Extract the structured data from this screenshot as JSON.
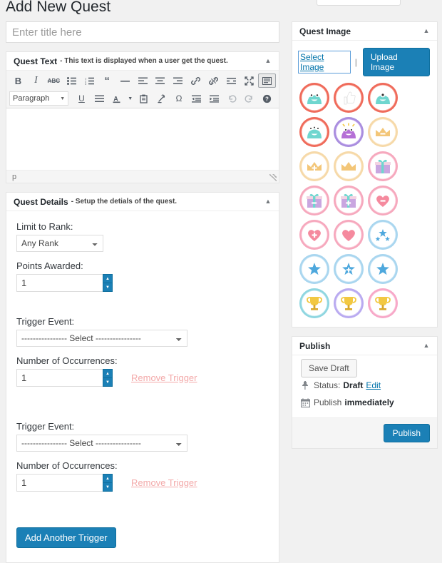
{
  "page": {
    "title": "Add New Quest"
  },
  "title_field": {
    "placeholder": "Enter title here",
    "value": ""
  },
  "quest_text_box": {
    "title": "Quest Text",
    "subtitle": "- This text is displayed when a user get the quest.",
    "toolbar_row1": [
      {
        "name": "bold-icon",
        "label": "B"
      },
      {
        "name": "italic-icon",
        "label": "I"
      },
      {
        "name": "strikethrough-icon",
        "label": "ABC"
      },
      {
        "name": "bulleted-list-icon",
        "label": ""
      },
      {
        "name": "numbered-list-icon",
        "label": ""
      },
      {
        "name": "blockquote-icon",
        "label": "“"
      },
      {
        "name": "horizontal-rule-icon",
        "label": "—"
      },
      {
        "name": "align-left-icon",
        "label": ""
      },
      {
        "name": "align-center-icon",
        "label": ""
      },
      {
        "name": "align-right-icon",
        "label": ""
      },
      {
        "name": "insert-link-icon",
        "label": ""
      },
      {
        "name": "unlink-icon",
        "label": ""
      },
      {
        "name": "read-more-icon",
        "label": ""
      },
      {
        "name": "fullscreen-icon",
        "label": ""
      },
      {
        "name": "toolbar-toggle-icon",
        "label": ""
      }
    ],
    "format_select": {
      "value": "Paragraph"
    },
    "toolbar_row2": [
      {
        "name": "underline-icon",
        "label": "U"
      },
      {
        "name": "justify-icon",
        "label": ""
      },
      {
        "name": "text-color-icon",
        "label": "A"
      },
      {
        "name": "text-color-chevron-icon",
        "label": ""
      },
      {
        "name": "paste-as-text-icon",
        "label": ""
      },
      {
        "name": "clear-formatting-icon",
        "label": ""
      },
      {
        "name": "special-character-icon",
        "label": "Ω"
      },
      {
        "name": "decrease-indent-icon",
        "label": ""
      },
      {
        "name": "increase-indent-icon",
        "label": ""
      },
      {
        "name": "undo-icon",
        "label": ""
      },
      {
        "name": "redo-icon",
        "label": ""
      },
      {
        "name": "keyboard-shortcuts-help-icon",
        "label": "?"
      }
    ],
    "content": "",
    "status_path": "p"
  },
  "quest_details_box": {
    "title": "Quest Details",
    "subtitle": "- Setup the detials of the quest.",
    "limit_rank_label": "Limit to Rank:",
    "limit_rank_value": "Any Rank",
    "points_label": "Points Awarded:",
    "points_value": "1",
    "triggers": [
      {
        "event_label": "Trigger Event:",
        "event_value": "---------------- Select ----------------",
        "occurrences_label": "Number of Occurrences:",
        "occurrences_value": "1",
        "remove_label": "Remove Trigger"
      },
      {
        "event_label": "Trigger Event:",
        "event_value": "---------------- Select ----------------",
        "occurrences_label": "Number of Occurrences:",
        "occurrences_value": "1",
        "remove_label": "Remove Trigger"
      }
    ],
    "add_trigger_label": "Add Another Trigger"
  },
  "quest_image_box": {
    "title": "Quest Image",
    "select_label": "Select Image",
    "separator": "|",
    "upload_label": "Upload Image",
    "badges": [
      {
        "name": "badge-monster-happy-red",
        "kind": "monster",
        "ring": "#ef6a5a",
        "body": "#6fd6cf",
        "ray": "#f9a79a"
      },
      {
        "name": "badge-thumbs-up-red",
        "kind": "thumb",
        "ring": "#ef6a5a",
        "body": "#ffffff",
        "ray": "#f9a79a"
      },
      {
        "name": "badge-monster-cyclops-red",
        "kind": "monster1",
        "ring": "#ef6a5a",
        "body": "#6fd6cf",
        "ray": "#f9a79a"
      },
      {
        "name": "badge-monster-many-eyes-red",
        "kind": "monster3",
        "ring": "#ef6a5a",
        "body": "#6fd6cf",
        "ray": "#f9a79a"
      },
      {
        "name": "badge-monster-purple",
        "kind": "monsterp",
        "ring": "#a98ede",
        "body": "#b56fd6",
        "ray": "#c9aef0"
      },
      {
        "name": "badge-crown-gold-minus",
        "kind": "crown-minus",
        "ring": "#f6d9a8",
        "body": "#f3c678",
        "ray": "#fbe9cd"
      },
      {
        "name": "badge-crown-gold-plus",
        "kind": "crown-plus",
        "ring": "#f6d9a8",
        "body": "#f3c678",
        "ray": "#fbe9cd"
      },
      {
        "name": "badge-crown-gold",
        "kind": "crown",
        "ring": "#f6d9a8",
        "body": "#f3c678",
        "ray": "#fbe9cd"
      },
      {
        "name": "badge-gift-pink",
        "kind": "gift",
        "ring": "#f6a8bd",
        "body": "#f7a8c0",
        "ray": "#fbd0dc"
      },
      {
        "name": "badge-gift-pink-minus",
        "kind": "gift-minus",
        "ring": "#f6a8bd",
        "body": "#f7a8c0",
        "ray": "#fbd0dc"
      },
      {
        "name": "badge-gift-pink-plus",
        "kind": "gift-plus",
        "ring": "#f6a8bd",
        "body": "#f7a8c0",
        "ray": "#fbd0dc"
      },
      {
        "name": "badge-heart-minus",
        "kind": "heart-minus",
        "ring": "#f6a8bd",
        "body": "#f58a9e",
        "ray": "#fbd0dc"
      },
      {
        "name": "badge-heart-plus",
        "kind": "heart-plus",
        "ring": "#f6a8bd",
        "body": "#f58a9e",
        "ray": "#fbd0dc"
      },
      {
        "name": "badge-heart",
        "kind": "heart",
        "ring": "#f6a8bd",
        "body": "#f58a9e",
        "ray": "#fbd0dc"
      },
      {
        "name": "badge-stars-blue",
        "kind": "stars",
        "ring": "#a9d6ef",
        "body": "#4ea8dd",
        "ray": "#cfe8f7"
      },
      {
        "name": "badge-star-blue",
        "kind": "star",
        "ring": "#a9d6ef",
        "body": "#4ea8dd",
        "ray": "#cfe8f7"
      },
      {
        "name": "badge-star-blue-plus",
        "kind": "star-plus",
        "ring": "#a9d6ef",
        "body": "#4ea8dd",
        "ray": "#cfe8f7"
      },
      {
        "name": "badge-star-blue-solid",
        "kind": "star2",
        "ring": "#a9d6ef",
        "body": "#4ea8dd",
        "ray": "#cfe8f7"
      },
      {
        "name": "badge-trophy-teal",
        "kind": "trophy",
        "ring": "#8fd6e0",
        "body": "#f2c842",
        "ray": "#bfe9ef"
      },
      {
        "name": "badge-trophy-purple",
        "kind": "trophy",
        "ring": "#b9aaf0",
        "body": "#f2c842",
        "ray": "#d6ccf7"
      },
      {
        "name": "badge-trophy-pink",
        "kind": "trophy",
        "ring": "#f7a8c8",
        "body": "#f2c842",
        "ray": "#fbd0e0"
      }
    ]
  },
  "publish_box": {
    "title": "Publish",
    "save_draft_label": "Save Draft",
    "status_prefix": "Status:",
    "status_value": "Draft",
    "status_edit_label": "Edit",
    "publish_prefix": "Publish",
    "publish_when": "immediately",
    "publish_label": "Publish"
  },
  "colors": {
    "accent": "#1b80b6",
    "link": "#0073aa",
    "bg": "#f1f1f1",
    "danger_light": "#f3a9a9"
  }
}
